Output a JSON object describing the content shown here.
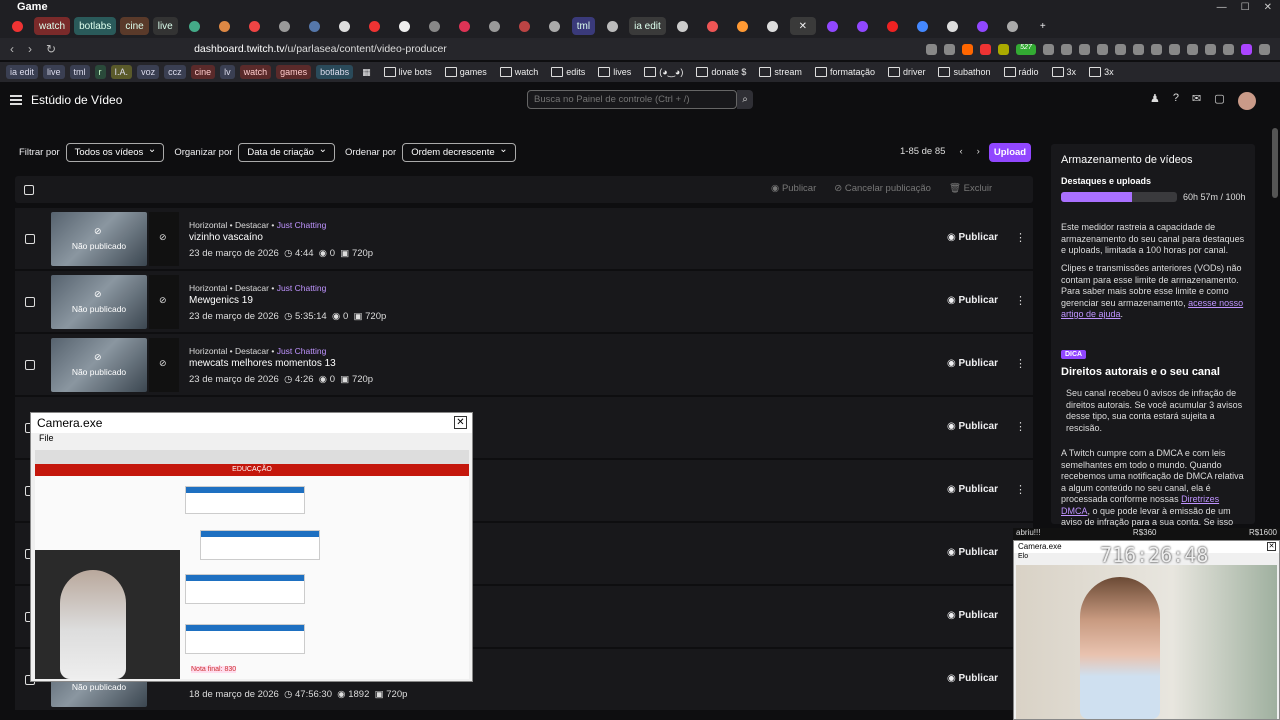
{
  "window": {
    "title": "Game"
  },
  "tabs": [
    "watch",
    "botlabs",
    "cine",
    "live",
    "tml",
    "ia edit"
  ],
  "browser": {
    "url_host": "dashboard.twitch.tv",
    "url_path": "/u/parlasea/content/video-producer",
    "badge": "527"
  },
  "bookmarks": {
    "chips": [
      "ia edit",
      "live",
      "tml",
      "r",
      "I.A.",
      "voz",
      "ccz",
      "cine",
      "lv",
      "watch",
      "games",
      "botlabs"
    ],
    "folders": [
      "live bots",
      "games",
      "watch",
      "edits",
      "lives",
      "(◕‿◕)",
      "donate $",
      "stream",
      "formatação",
      "driver",
      "subathon",
      "rádio",
      "3x",
      "3x"
    ]
  },
  "header": {
    "title": "Estúdio de Vídeo",
    "search_placeholder": "Busca no Painel de controle (Ctrl + /)"
  },
  "filters": {
    "filter_label": "Filtrar por",
    "filter_value": "Todos os vídeos",
    "organize_label": "Organizar por",
    "organize_value": "Data de criação",
    "order_label": "Ordenar por",
    "order_value": "Ordem decrescente"
  },
  "pager": {
    "range": "1-85 de 85",
    "upload": "Upload"
  },
  "bulk_actions": {
    "publish": "Publicar",
    "unpublish": "Cancelar publicação",
    "delete": "Excluir"
  },
  "row_common": {
    "not_published": "Não publicado",
    "publish": "Publicar",
    "category": "Just Chatting",
    "meta_prefix": "Horizontal • Destacar • "
  },
  "videos": [
    {
      "title": "vizinho vascaíno",
      "date": "23 de março de 2026",
      "duration": "4:44",
      "views": "0",
      "quality": "720p"
    },
    {
      "title": "Mewgenics 19",
      "date": "23 de março de 2026",
      "duration": "5:35:14",
      "views": "0",
      "quality": "720p"
    },
    {
      "title": "mewcats melhores momentos 13",
      "date": "23 de março de 2026",
      "duration": "4:26",
      "views": "0",
      "quality": "720p"
    },
    {
      "title": "",
      "date": "18 de março de 2026",
      "duration": "47:56:30",
      "views": "1892",
      "quality": "720p"
    }
  ],
  "storage_panel": {
    "title": "Armazenamento de vídeos",
    "subtitle": "Destaques e uploads",
    "usage": "60h 57m / 100h",
    "usage_fraction": 0.61,
    "p1": "Este medidor rastreia a capacidade de armazenamento do seu canal para destaques e uploads, limitada a 100 horas por canal.",
    "p2": "Clipes e transmissões anteriores (VODs) não contam para esse limite de armazenamento. Para saber mais sobre esse limite e como gerenciar seu armazenamento,",
    "p2_link": "acesse nosso artigo de ajuda",
    "tip": "DICA",
    "copyright_title": "Direitos autorais e o seu canal",
    "p3": "Seu canal recebeu 0 avisos de infração de direitos autorais. Se você acumular 3 avisos desse tipo, sua conta estará sujeita a rescisão.",
    "p4": "A Twitch cumpre com a DMCA e com leis semelhantes em todo o mundo. Quando recebemos uma notificação de DMCA relativa a algum conteúdo no seu canal, ela é processada conforme nossas",
    "p4_link": "Diretrizes DMCA",
    "p4_end": ", o que pode levar à emissão de um aviso de infração para a sua conta. Se isso"
  },
  "camera1": {
    "title": "Camera.exe",
    "menu": "File",
    "site_header": "EDUCAÇÃO",
    "final_text": "Nota final: 830"
  },
  "camera2": {
    "title": "Camera.exe",
    "menu": "Elo",
    "timer": "716:26:48",
    "stats_left": "abriu!!!",
    "stats_mid": "R$360",
    "stats_right": "R$1600"
  },
  "colors": {
    "accent": "#9147ff",
    "link": "#bf94ff",
    "bg": "#0e0e10",
    "row": "#18181b"
  }
}
